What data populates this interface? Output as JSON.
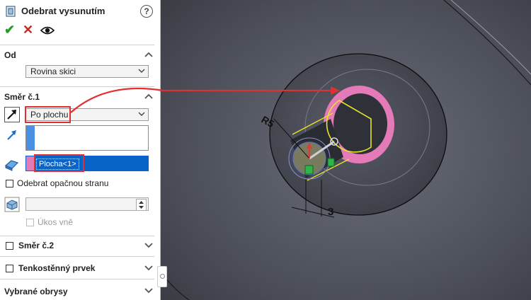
{
  "panel": {
    "title": "Odebrat vysunutím",
    "help_symbol": "?",
    "actions": {
      "ok_symbol": "✔",
      "cancel_symbol": "✕"
    },
    "section_from": {
      "title": "Od",
      "value": "Rovina skici"
    },
    "section_direction1": {
      "title": "Směr č.1",
      "end_condition": "Po plochu",
      "face_selection": "Plocha<1>",
      "flip_side_label": "Odebrat opačnou stranu",
      "draft_outward_label": "Úkos vně"
    },
    "section_direction2": {
      "title": "Směr č.2"
    },
    "section_thin": {
      "title": "Tenkostěnný prvek"
    },
    "section_contours": {
      "title": "Vybrané obrysy"
    }
  },
  "viewport": {
    "dimension_radius": "R5",
    "dimension_linear": "3"
  },
  "colors": {
    "accent_blue": "#0a64c8",
    "highlight_red": "#e0302f",
    "face_pink": "#e57ab8",
    "sketch_yellow": "#e9e22a",
    "confirm_green": "#2a9a2a"
  }
}
